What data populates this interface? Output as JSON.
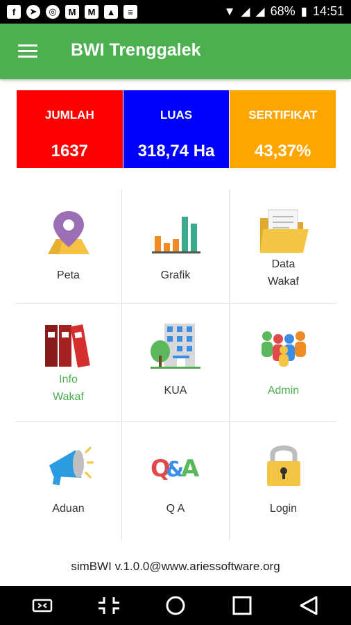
{
  "status_bar": {
    "battery": "68%",
    "time": "14:51",
    "icons": [
      "facebook-icon",
      "telegram-icon",
      "chrome-icon",
      "gmail-icon",
      "gmail-icon",
      "image-icon",
      "message-icon",
      "wifi-icon",
      "no-signal-icon",
      "signal-icon",
      "battery-icon"
    ]
  },
  "app_bar": {
    "title": "BWI Trenggalek",
    "menu_icon": "hamburger-menu-icon"
  },
  "stats": [
    {
      "label": "JUMLAH",
      "value": "1637",
      "color": "#ff0000"
    },
    {
      "label": "LUAS",
      "value": "318,74 Ha",
      "color": "#0000ff"
    },
    {
      "label": "SERTIFIKAT",
      "value": "43,37%",
      "color": "#ffa500"
    }
  ],
  "menu": [
    {
      "label": "Peta",
      "icon": "map-pin-icon"
    },
    {
      "label": "Grafik",
      "icon": "bar-chart-icon"
    },
    {
      "label": "Data Wakaf",
      "line1": "Data",
      "line2": "Wakaf",
      "icon": "folder-icon"
    },
    {
      "label": "Info Wakaf",
      "line1": "Info",
      "line2": "Wakaf",
      "icon": "binders-icon"
    },
    {
      "label": "KUA",
      "icon": "building-icon"
    },
    {
      "label": "Admin",
      "icon": "people-icon"
    },
    {
      "label": "Aduan",
      "icon": "megaphone-icon"
    },
    {
      "label": "Q A",
      "icon": "qa-icon"
    },
    {
      "label": "Login",
      "icon": "padlock-icon"
    }
  ],
  "footer": "simBWI v.1.0.0@www.ariessoftware.org",
  "colors": {
    "accent": "#4caf50"
  }
}
